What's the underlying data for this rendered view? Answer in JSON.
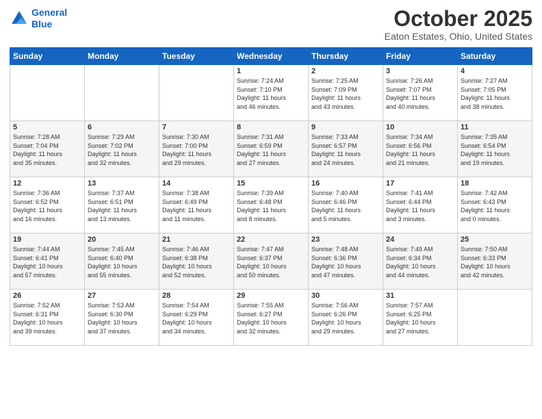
{
  "header": {
    "logo_line1": "General",
    "logo_line2": "Blue",
    "month_title": "October 2025",
    "subtitle": "Eaton Estates, Ohio, United States"
  },
  "days_of_week": [
    "Sunday",
    "Monday",
    "Tuesday",
    "Wednesday",
    "Thursday",
    "Friday",
    "Saturday"
  ],
  "weeks": [
    [
      {
        "day": "",
        "content": ""
      },
      {
        "day": "",
        "content": ""
      },
      {
        "day": "",
        "content": ""
      },
      {
        "day": "1",
        "content": "Sunrise: 7:24 AM\nSunset: 7:10 PM\nDaylight: 11 hours\nand 46 minutes."
      },
      {
        "day": "2",
        "content": "Sunrise: 7:25 AM\nSunset: 7:09 PM\nDaylight: 11 hours\nand 43 minutes."
      },
      {
        "day": "3",
        "content": "Sunrise: 7:26 AM\nSunset: 7:07 PM\nDaylight: 11 hours\nand 40 minutes."
      },
      {
        "day": "4",
        "content": "Sunrise: 7:27 AM\nSunset: 7:05 PM\nDaylight: 11 hours\nand 38 minutes."
      }
    ],
    [
      {
        "day": "5",
        "content": "Sunrise: 7:28 AM\nSunset: 7:04 PM\nDaylight: 11 hours\nand 35 minutes."
      },
      {
        "day": "6",
        "content": "Sunrise: 7:29 AM\nSunset: 7:02 PM\nDaylight: 11 hours\nand 32 minutes."
      },
      {
        "day": "7",
        "content": "Sunrise: 7:30 AM\nSunset: 7:00 PM\nDaylight: 11 hours\nand 29 minutes."
      },
      {
        "day": "8",
        "content": "Sunrise: 7:31 AM\nSunset: 6:59 PM\nDaylight: 11 hours\nand 27 minutes."
      },
      {
        "day": "9",
        "content": "Sunrise: 7:33 AM\nSunset: 6:57 PM\nDaylight: 11 hours\nand 24 minutes."
      },
      {
        "day": "10",
        "content": "Sunrise: 7:34 AM\nSunset: 6:56 PM\nDaylight: 11 hours\nand 21 minutes."
      },
      {
        "day": "11",
        "content": "Sunrise: 7:35 AM\nSunset: 6:54 PM\nDaylight: 11 hours\nand 19 minutes."
      }
    ],
    [
      {
        "day": "12",
        "content": "Sunrise: 7:36 AM\nSunset: 6:52 PM\nDaylight: 11 hours\nand 16 minutes."
      },
      {
        "day": "13",
        "content": "Sunrise: 7:37 AM\nSunset: 6:51 PM\nDaylight: 11 hours\nand 13 minutes."
      },
      {
        "day": "14",
        "content": "Sunrise: 7:38 AM\nSunset: 6:49 PM\nDaylight: 11 hours\nand 11 minutes."
      },
      {
        "day": "15",
        "content": "Sunrise: 7:39 AM\nSunset: 6:48 PM\nDaylight: 11 hours\nand 8 minutes."
      },
      {
        "day": "16",
        "content": "Sunrise: 7:40 AM\nSunset: 6:46 PM\nDaylight: 11 hours\nand 5 minutes."
      },
      {
        "day": "17",
        "content": "Sunrise: 7:41 AM\nSunset: 6:44 PM\nDaylight: 11 hours\nand 3 minutes."
      },
      {
        "day": "18",
        "content": "Sunrise: 7:42 AM\nSunset: 6:43 PM\nDaylight: 11 hours\nand 0 minutes."
      }
    ],
    [
      {
        "day": "19",
        "content": "Sunrise: 7:44 AM\nSunset: 6:41 PM\nDaylight: 10 hours\nand 57 minutes."
      },
      {
        "day": "20",
        "content": "Sunrise: 7:45 AM\nSunset: 6:40 PM\nDaylight: 10 hours\nand 55 minutes."
      },
      {
        "day": "21",
        "content": "Sunrise: 7:46 AM\nSunset: 6:38 PM\nDaylight: 10 hours\nand 52 minutes."
      },
      {
        "day": "22",
        "content": "Sunrise: 7:47 AM\nSunset: 6:37 PM\nDaylight: 10 hours\nand 50 minutes."
      },
      {
        "day": "23",
        "content": "Sunrise: 7:48 AM\nSunset: 6:36 PM\nDaylight: 10 hours\nand 47 minutes."
      },
      {
        "day": "24",
        "content": "Sunrise: 7:49 AM\nSunset: 6:34 PM\nDaylight: 10 hours\nand 44 minutes."
      },
      {
        "day": "25",
        "content": "Sunrise: 7:50 AM\nSunset: 6:33 PM\nDaylight: 10 hours\nand 42 minutes."
      }
    ],
    [
      {
        "day": "26",
        "content": "Sunrise: 7:52 AM\nSunset: 6:31 PM\nDaylight: 10 hours\nand 39 minutes."
      },
      {
        "day": "27",
        "content": "Sunrise: 7:53 AM\nSunset: 6:30 PM\nDaylight: 10 hours\nand 37 minutes."
      },
      {
        "day": "28",
        "content": "Sunrise: 7:54 AM\nSunset: 6:29 PM\nDaylight: 10 hours\nand 34 minutes."
      },
      {
        "day": "29",
        "content": "Sunrise: 7:55 AM\nSunset: 6:27 PM\nDaylight: 10 hours\nand 32 minutes."
      },
      {
        "day": "30",
        "content": "Sunrise: 7:56 AM\nSunset: 6:26 PM\nDaylight: 10 hours\nand 29 minutes."
      },
      {
        "day": "31",
        "content": "Sunrise: 7:57 AM\nSunset: 6:25 PM\nDaylight: 10 hours\nand 27 minutes."
      },
      {
        "day": "",
        "content": ""
      }
    ]
  ]
}
